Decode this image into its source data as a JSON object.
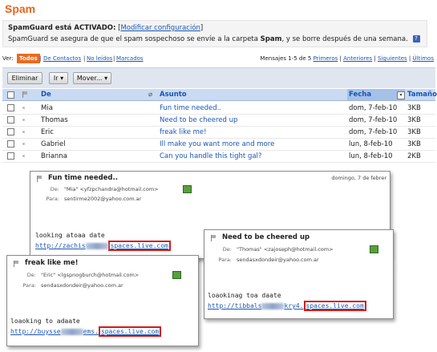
{
  "page_title": "Spam",
  "spamguard": {
    "status_text": "SpamGuard está ACTIVADO:",
    "modify_link": "Modificar configuración",
    "desc_pre": "SpamGuard se asegura de que el spam sospechoso se envíe a la carpeta",
    "desc_bold": "Spam",
    "desc_post": ", y se borre después de una semana."
  },
  "filter": {
    "ver_label": "Ver:",
    "todos": "Todos",
    "contactos": "De Contactos",
    "no_leidos": "No leídos",
    "marcados": "Marcados"
  },
  "pager": {
    "info": "Mensajes 1-5 de 5",
    "primeros": "Primeros",
    "anteriores": "Anteriores",
    "siguientes": "Siguientes",
    "ultimos": "Últimos",
    "sep": "|"
  },
  "toolbar": {
    "eliminar": "Eliminar",
    "ir": "Ir",
    "mover": "Mover..."
  },
  "columns": {
    "de": "De",
    "asunto": "Asunto",
    "fecha": "Fecha",
    "tamano": "Tamaño"
  },
  "rows": [
    {
      "from": "Mia",
      "subject": "Fun time needed..",
      "date": "dom, 7-feb-10",
      "size": "3KB"
    },
    {
      "from": "Thomas",
      "subject": "Need to be cheered up",
      "date": "dom, 7-feb-10",
      "size": "3KB"
    },
    {
      "from": "Eric",
      "subject": "freak like me!",
      "date": "dom, 7-feb-10",
      "size": "3KB"
    },
    {
      "from": "Gabriel",
      "subject": "Ill make you want more and more",
      "date": "lun, 8-feb-10",
      "size": "3KB"
    },
    {
      "from": "Brianna",
      "subject": "Can you handle this tight gal?",
      "date": "lun, 8-feb-10",
      "size": "2KB"
    }
  ],
  "cards": {
    "mia": {
      "title": "Fun time needed..",
      "date": "domingo, 7 de febrer",
      "from_label": "De:",
      "from": "\"Mia\" <yfzpchandra@hotmail.com>",
      "to_label": "Para:",
      "to": "sentirme2002@yahoo.com.ar",
      "body": "looking atoaa date",
      "url_pre": "http://zachis",
      "url_hl": "spaces.live.com"
    },
    "thomas": {
      "title": "Need to be cheered up",
      "from_label": "De:",
      "from": "\"Thomas\" <zajoseph@hotmail.com>",
      "to_label": "Para:",
      "to": "sendasxdondeir@yahoo.com.ar",
      "body": "loaokinag toa daate",
      "url_pre": "http://tibbals",
      "url_mid": "kry4.",
      "url_hl": "spaces.live.com"
    },
    "eric": {
      "title": "freak like me!",
      "from_label": "De:",
      "from": "\"Eric\" <lgspnogburch@hotmail.com>",
      "to_label": "Para:",
      "to": "sendasxdondeir@yahoo.com.ar",
      "body": "loaoking to adaate",
      "url_pre": "http://buysse",
      "url_mid": "ems.",
      "url_hl": "spaces.live.com"
    }
  },
  "colors": {
    "accent": "#e8641e",
    "link": "#1a56b5",
    "header_bg": "#c9daf2",
    "highlight_box": "#d41a1a"
  }
}
